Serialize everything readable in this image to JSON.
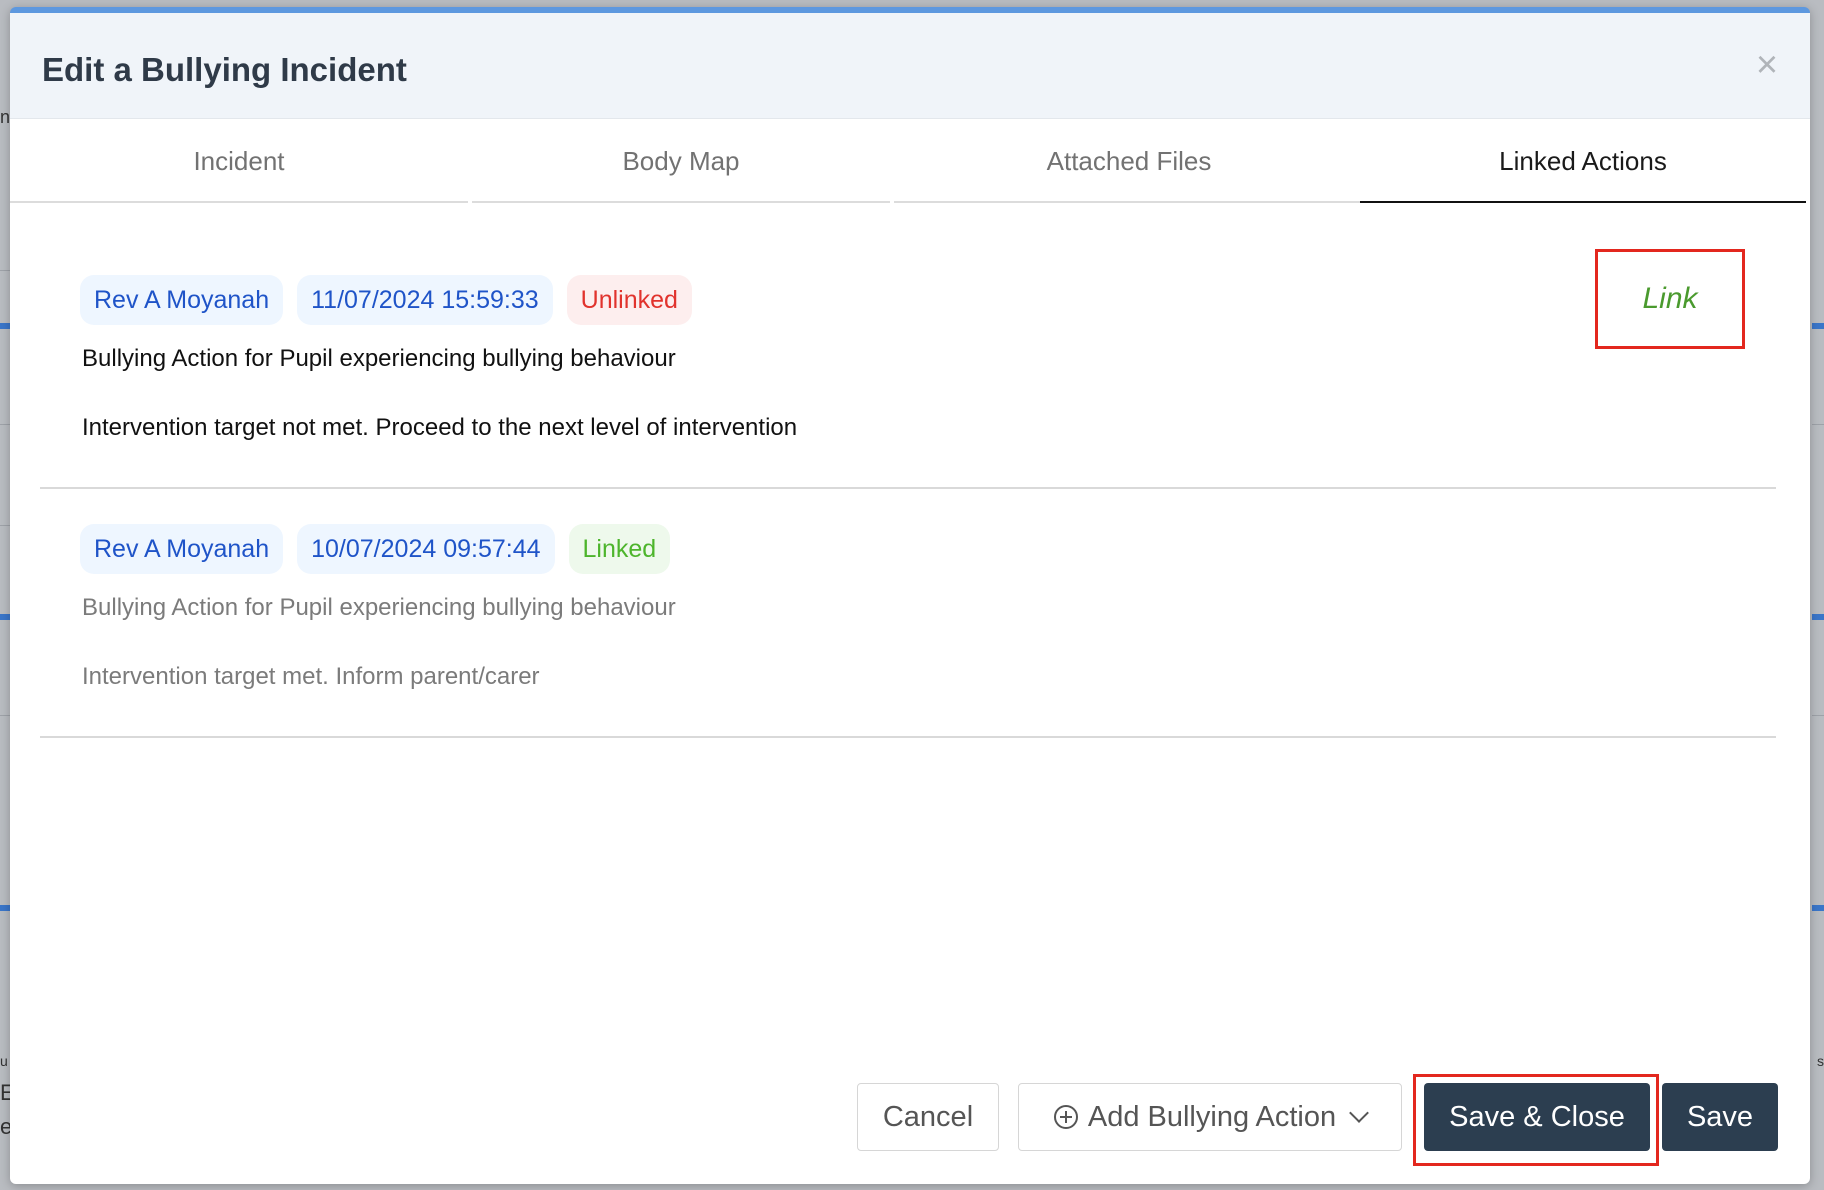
{
  "backdrop": {
    "left_text_1": "n",
    "left_text_2": "u",
    "left_text_3": "E",
    "left_text_4": "e",
    "right_text_1": "s"
  },
  "modal": {
    "title": "Edit a Bullying Incident",
    "close_symbol": "×"
  },
  "tabs": [
    {
      "label": "Incident",
      "active": false
    },
    {
      "label": "Body Map",
      "active": false
    },
    {
      "label": "Attached Files",
      "active": false
    },
    {
      "label": "Linked Actions",
      "active": true
    }
  ],
  "actions": [
    {
      "author": "Rev A Moyanah",
      "timestamp": "11/07/2024 15:59:33",
      "status": "Unlinked",
      "title": "Bullying Action for Pupil experiencing bullying behaviour",
      "description": "Intervention target not met. Proceed to the next level of intervention"
    },
    {
      "author": "Rev A Moyanah",
      "timestamp": "10/07/2024 09:57:44",
      "status": "Linked",
      "title": "Bullying Action for Pupil experiencing bullying behaviour",
      "description": "Intervention target met. Inform parent/carer"
    }
  ],
  "link_button": {
    "label": "Link"
  },
  "footer": {
    "cancel_label": "Cancel",
    "add_action_label": "Add Bullying Action",
    "save_close_label": "Save & Close",
    "save_label": "Save"
  },
  "colors": {
    "header_accent": "#5d98df",
    "primary_button": "#2c3e50",
    "highlight_frame": "#e3271e",
    "chip_blue": "#1f54c8",
    "status_unlinked": "#e1332d",
    "status_linked": "#4db52c",
    "link_text": "#4a9a2e"
  },
  "icons": {
    "close": "close-icon",
    "add": "plus-circle-icon",
    "dropdown": "chevron-down-icon"
  }
}
